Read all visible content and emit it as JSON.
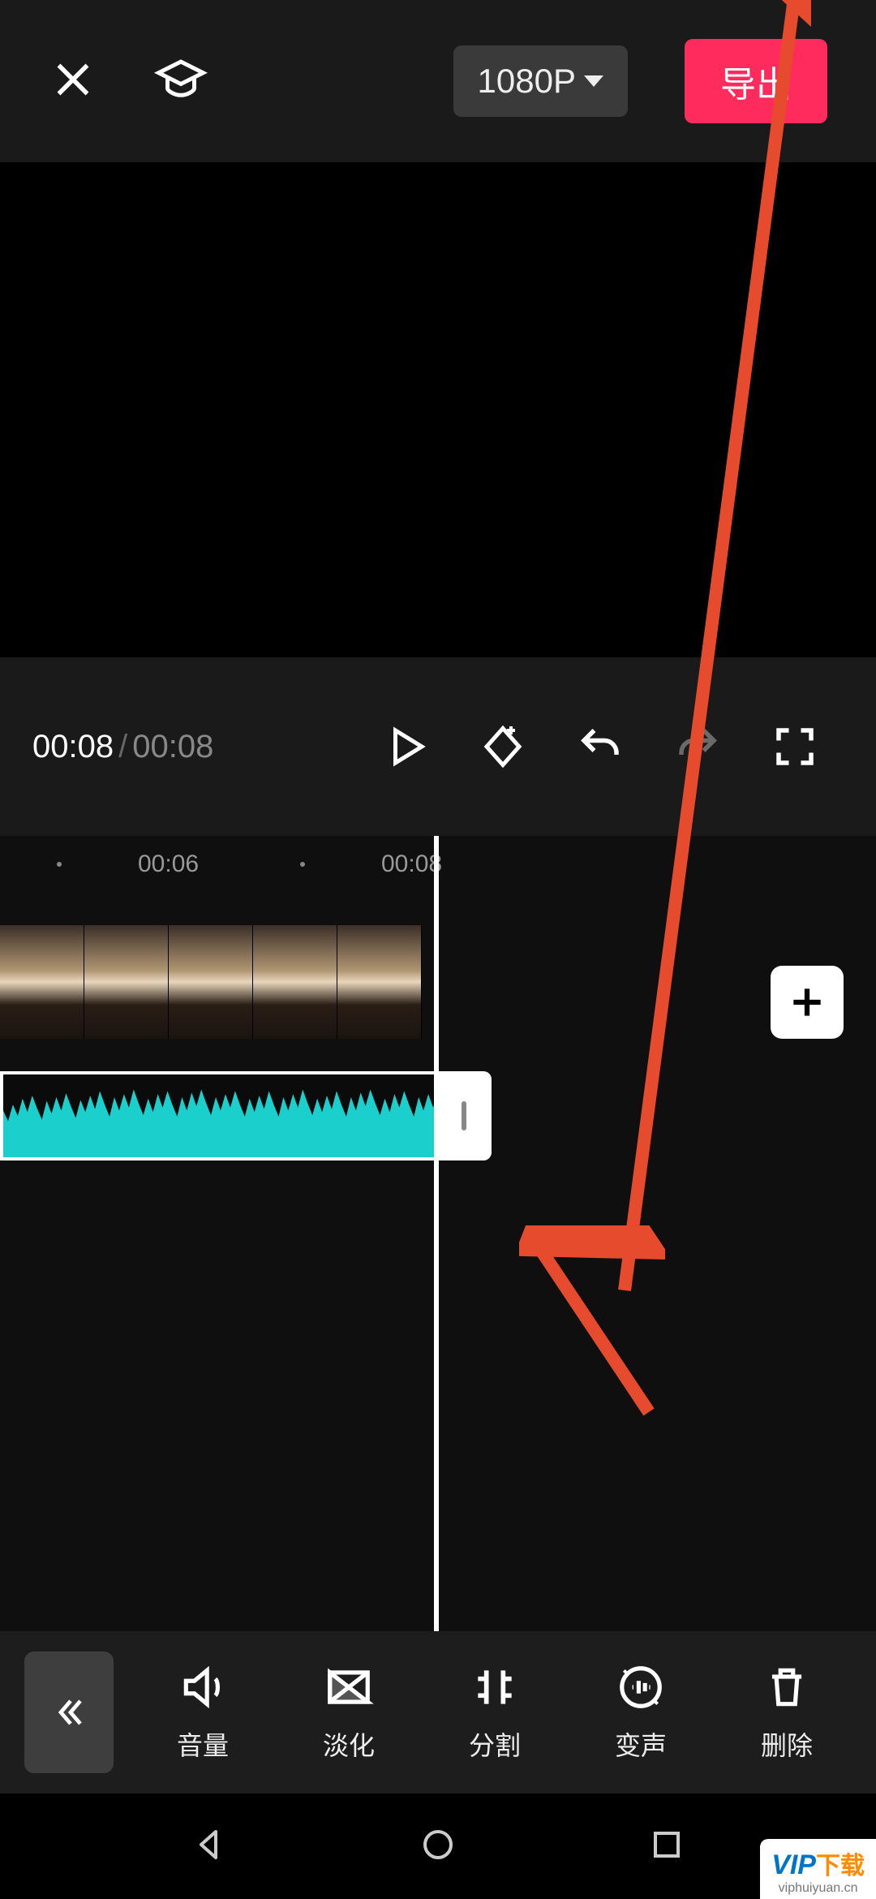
{
  "topbar": {
    "resolution_label": "1080P",
    "export_label": "导出"
  },
  "playback": {
    "current_time": "00:08",
    "total_time": "00:08"
  },
  "ruler": {
    "ticks": [
      "00:06",
      "00:08"
    ]
  },
  "add_clip_label": "+",
  "toolbar": {
    "volume_label": "音量",
    "fade_label": "淡化",
    "split_label": "分割",
    "voice_label": "变声",
    "delete_label": "删除"
  },
  "colors": {
    "accent": "#ff2b5c",
    "waveform": "#1bd0cc",
    "annotation": "#e54b2c"
  },
  "watermark": {
    "brand_prefix": "VIP",
    "brand_suffix": "下载",
    "url": "viphuiyuan.cn"
  }
}
